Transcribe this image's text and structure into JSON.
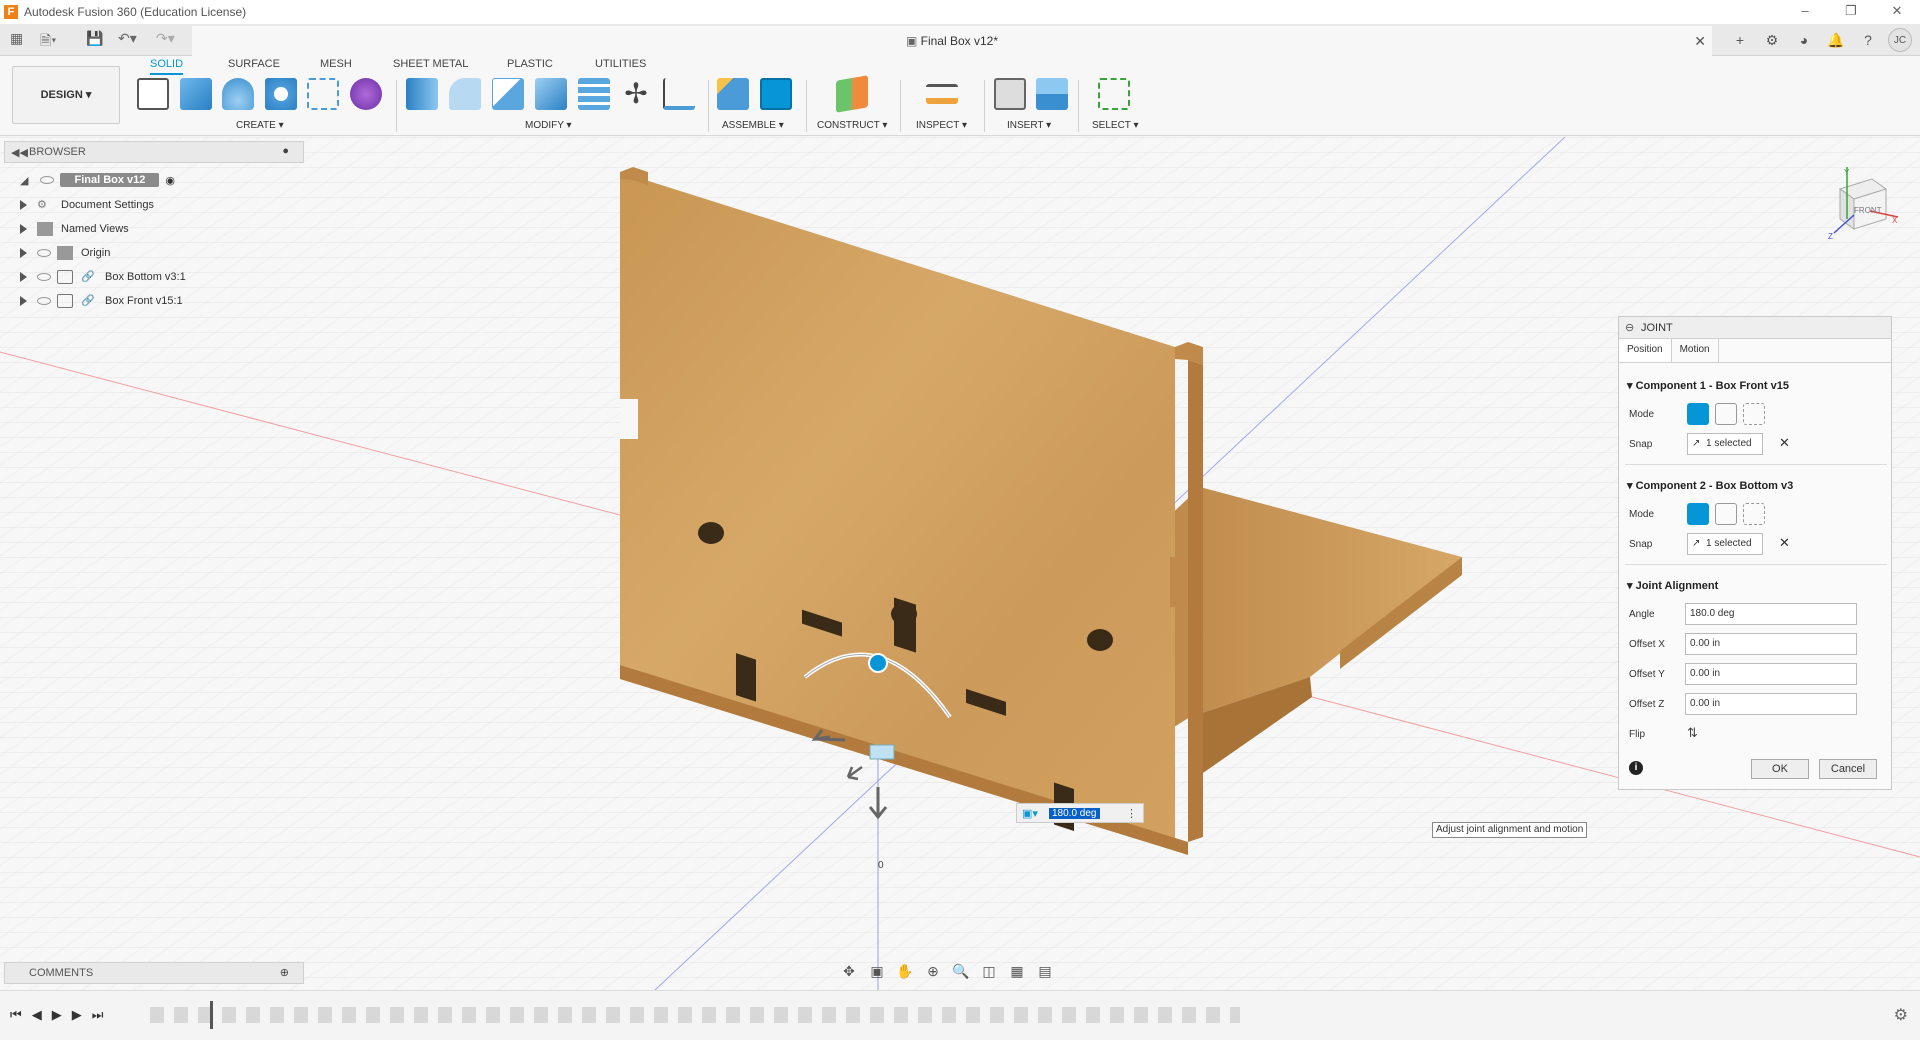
{
  "app": {
    "window_title": "Autodesk Fusion 360 (Education License)",
    "logo_letter": "F"
  },
  "document": {
    "tab_title": "Final Box v12*",
    "user_initials": "JC"
  },
  "toolbar": {
    "workspace": "DESIGN",
    "tabs": [
      "SOLID",
      "SURFACE",
      "MESH",
      "SHEET METAL",
      "PLASTIC",
      "UTILITIES"
    ],
    "active_tab": "SOLID",
    "groups": [
      "CREATE",
      "MODIFY",
      "ASSEMBLE",
      "CONSTRUCT",
      "INSPECT",
      "INSERT",
      "SELECT"
    ]
  },
  "browser": {
    "title": "BROWSER",
    "items": [
      {
        "label": "Final Box v12"
      },
      {
        "label": "Document Settings"
      },
      {
        "label": "Named Views"
      },
      {
        "label": "Origin"
      },
      {
        "label": "Box Bottom v3:1"
      },
      {
        "label": "Box Front v15:1"
      }
    ]
  },
  "comments": {
    "title": "COMMENTS"
  },
  "viewcube": {
    "face": "FRONT",
    "axes": [
      "Y",
      "X",
      "Z"
    ]
  },
  "viewport": {
    "angle_input": "180.0 deg",
    "origin_label": "0",
    "tooltip": "Adjust joint alignment and motion"
  },
  "joint_panel": {
    "title": "JOINT",
    "tabs": [
      "Position",
      "Motion"
    ],
    "component1": {
      "header": "Component 1 - Box Front v15",
      "mode_label": "Mode",
      "snap_label": "Snap",
      "snap_value": "1 selected"
    },
    "component2": {
      "header": "Component 2 - Box Bottom v3",
      "mode_label": "Mode",
      "snap_label": "Snap",
      "snap_value": "1 selected"
    },
    "alignment": {
      "header": "Joint Alignment",
      "angle_label": "Angle",
      "angle_value": "180.0 deg",
      "offset_x_label": "Offset X",
      "offset_x_value": "0.00 in",
      "offset_y_label": "Offset Y",
      "offset_y_value": "0.00 in",
      "offset_z_label": "Offset Z",
      "offset_z_value": "0.00 in",
      "flip_label": "Flip"
    },
    "ok_label": "OK",
    "cancel_label": "Cancel"
  },
  "colors": {
    "accent": "#0696d7",
    "wood": "#d4a165",
    "wood_dark": "#b98143",
    "grid_line": "#dcdcdc"
  }
}
